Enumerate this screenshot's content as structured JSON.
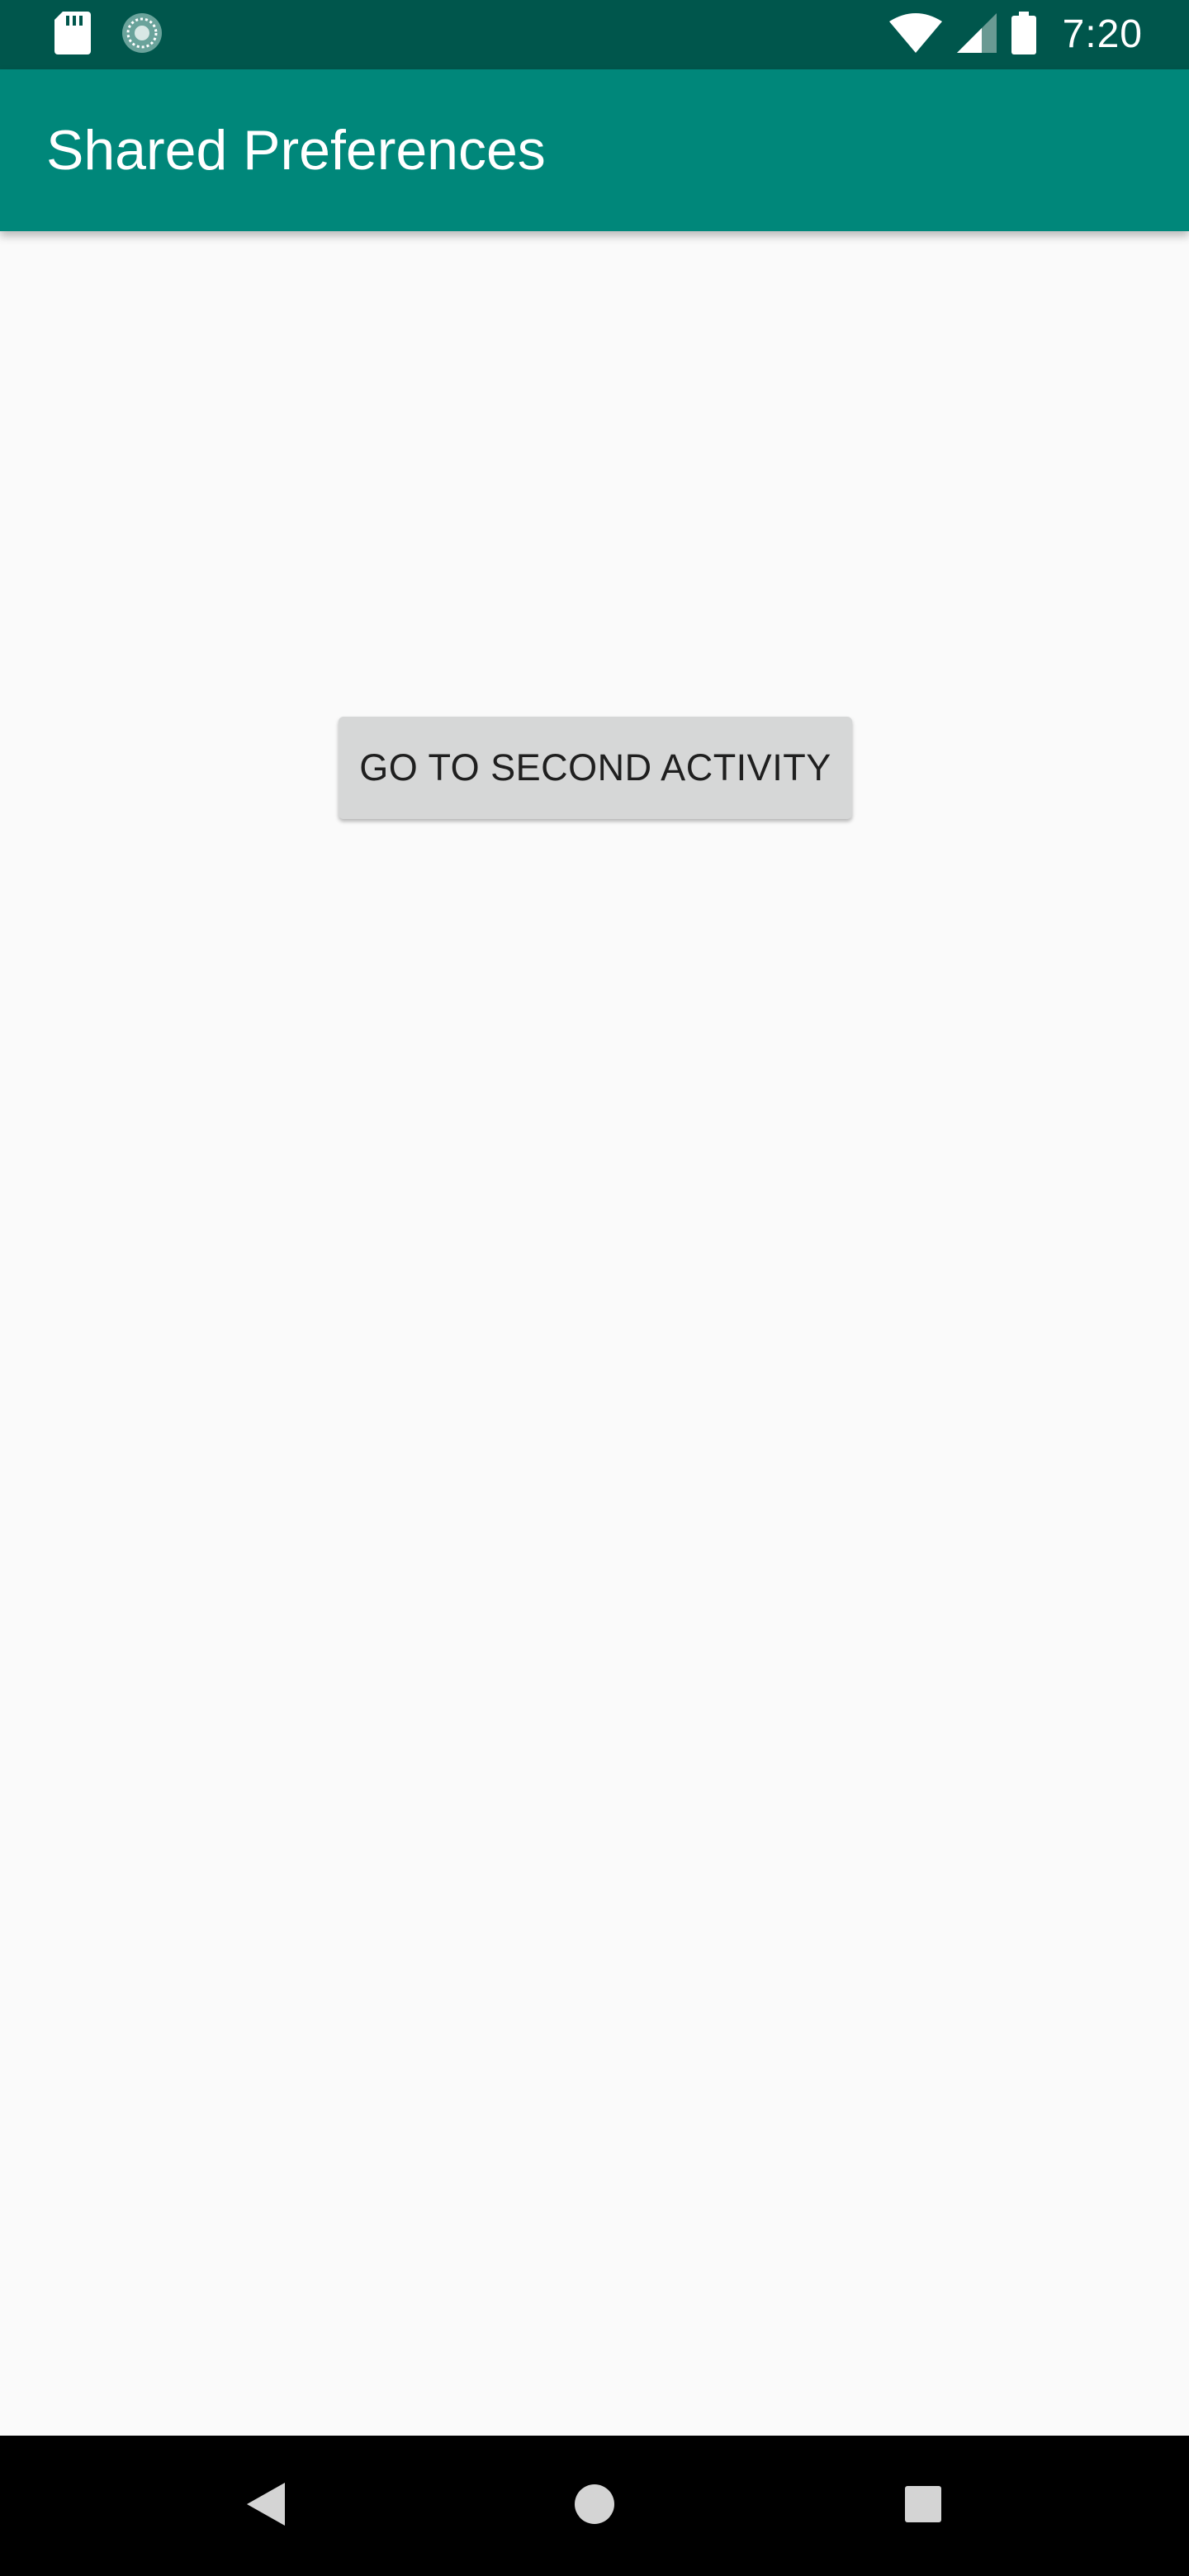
{
  "status_bar": {
    "time": "7:20",
    "left_icons": [
      "sd-card-icon",
      "sync-icon"
    ],
    "right_icons": [
      "wifi-icon",
      "cell-signal-icon",
      "battery-icon"
    ],
    "background_color": "#00564c"
  },
  "app_bar": {
    "title": "Shared Preferences",
    "background_color": "#00877a"
  },
  "main": {
    "button_label": "GO TO SECOND ACTIVITY",
    "background_color": "#fafafa"
  },
  "nav_bar": {
    "buttons": [
      "back-icon",
      "home-icon",
      "recents-icon"
    ]
  }
}
